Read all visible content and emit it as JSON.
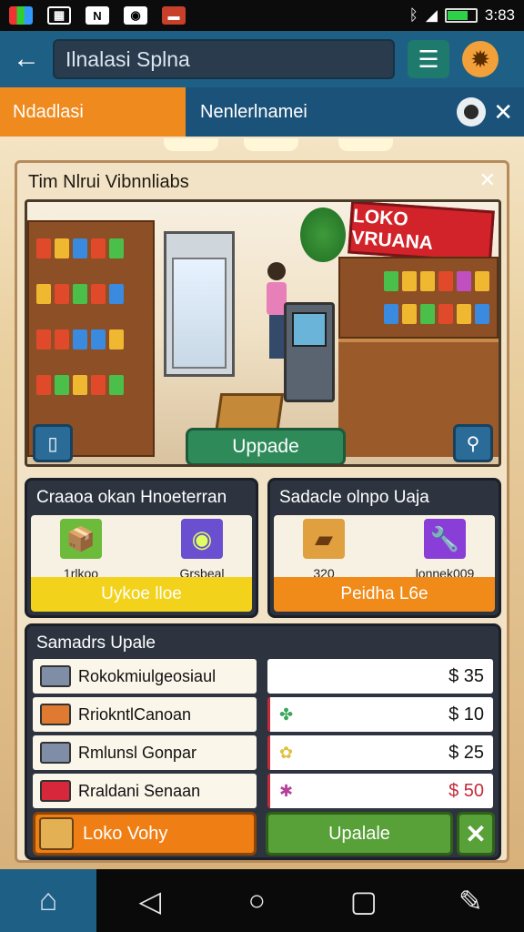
{
  "status_bar": {
    "time": "3:83",
    "icons": [
      "photo-icon",
      "image-icon",
      "n-app-icon",
      "camera-icon",
      "notification-icon"
    ],
    "right_icons": [
      "bluetooth-icon",
      "signal-icon",
      "battery-icon"
    ],
    "battery_level": 0.75
  },
  "app_bar": {
    "search_text": "Ilnalasi Splna"
  },
  "tabs": [
    {
      "label": "Ndadlasi"
    },
    {
      "label": "Nenlerlnamei"
    }
  ],
  "panel": {
    "title": "Tim Nlrui Vibnnliabs",
    "store_sign": "LOKO VRUANA",
    "update_button": "Uppade"
  },
  "cards": [
    {
      "title": "Craaoa okan Hnoeterran",
      "items": [
        {
          "label": "1rlkoo",
          "icon": "box-icon"
        },
        {
          "label": "Grsbeal",
          "icon": "camera-icon"
        }
      ],
      "footer": "Uykoe lloe",
      "footer_color": "#f2d21a"
    },
    {
      "title": "Sadacle olnpo Uaja",
      "items": [
        {
          "label": "320",
          "icon": "wood-icon"
        },
        {
          "label": "lonnek009",
          "icon": "wrench-icon"
        }
      ],
      "footer": "Peidha L6e",
      "footer_color": "#f08a18"
    }
  ],
  "list": {
    "title": "Samadrs Upale",
    "rows": [
      {
        "name": "Rokokmiulgeosiaul",
        "color": "#7f8ea6",
        "price_icon": "clover-icon",
        "price_color": "#3aa65a",
        "price": "$ 35",
        "price_text_color": "#111111"
      },
      {
        "name": "RriokntlCanoan",
        "color": "#e07a30",
        "price_icon": "clover-icon",
        "price_color": "#3aa65a",
        "price": "$ 10",
        "price_text_color": "#111111"
      },
      {
        "name": "Rmlunsl Gonpar",
        "color": "#7f8ea6",
        "price_icon": "flower-icon",
        "price_color": "#e0c040",
        "price": "$ 25",
        "price_text_color": "#111111"
      },
      {
        "name": "Rraldani Senaan",
        "color": "#d6283a",
        "price_icon": "flower-icon",
        "price_color": "#b8409a",
        "price": "$ 50",
        "price_text_color": "#c52a3a"
      }
    ],
    "primary_button": "Loko Vohy",
    "secondary_button": "Upalale",
    "close_symbol": "✕"
  },
  "nav_bar": {
    "items": [
      "home-icon",
      "back-icon",
      "home-circle-icon",
      "recents-icon",
      "edit-icon"
    ]
  },
  "colors": {
    "app_bar": "#1e5f86",
    "tab_active": "#ef8a1e",
    "tab_inactive": "#1b5279",
    "panel_bg": "#f3e3c6"
  }
}
